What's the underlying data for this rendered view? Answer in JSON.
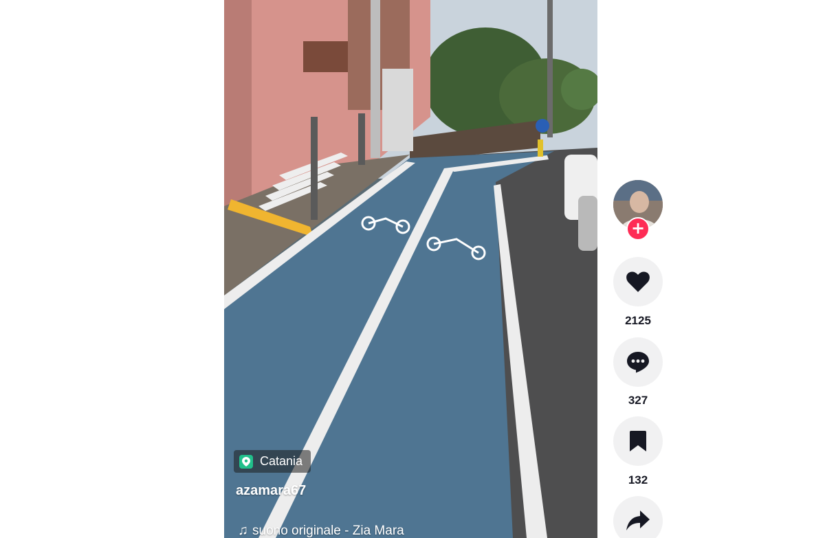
{
  "video": {
    "location_label": "Catania",
    "author": "azamara67",
    "sound": "suono originale - Zia Mara"
  },
  "actions": {
    "likes": "2125",
    "comments": "327",
    "saves": "132"
  },
  "icons": {
    "location": "location-pin-icon",
    "note": "music-note-icon",
    "like": "heart-icon",
    "comment": "comment-icon",
    "save": "bookmark-icon",
    "share": "share-icon",
    "follow": "plus-icon"
  },
  "colors": {
    "follow_accent": "#fe2c55",
    "location_accent": "#21c08b",
    "action_bg": "#f1f1f2",
    "text_dark": "#161823"
  }
}
